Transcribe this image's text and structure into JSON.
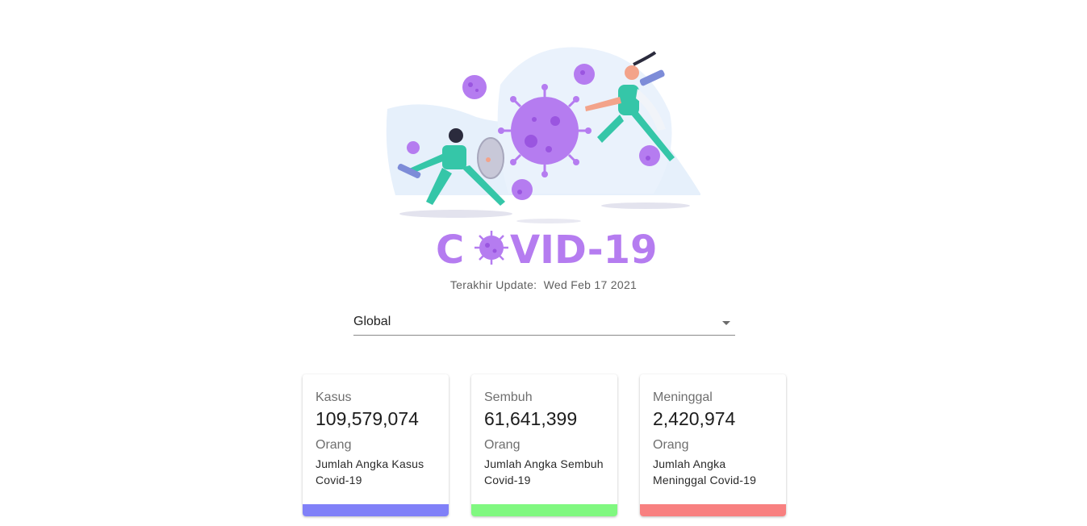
{
  "logo": {
    "text_before": "C",
    "text_after": "VID-19",
    "color": "#b57cf0"
  },
  "update": {
    "label": "Terakhir Update:",
    "date": "Wed Feb 17 2021"
  },
  "region_select": {
    "value": "Global"
  },
  "cards": [
    {
      "title": "Kasus",
      "value": "109,579,074",
      "unit": "Orang",
      "description": "Jumlah Angka Kasus Covid-19",
      "color": "#8080f8"
    },
    {
      "title": "Sembuh",
      "value": "61,641,399",
      "unit": "Orang",
      "description": "Jumlah Angka Sembuh Covid-19",
      "color": "#80f880"
    },
    {
      "title": "Meninggal",
      "value": "2,420,974",
      "unit": "Orang",
      "description": "Jumlah Angka Meninggal Covid-19",
      "color": "#f88080"
    }
  ]
}
